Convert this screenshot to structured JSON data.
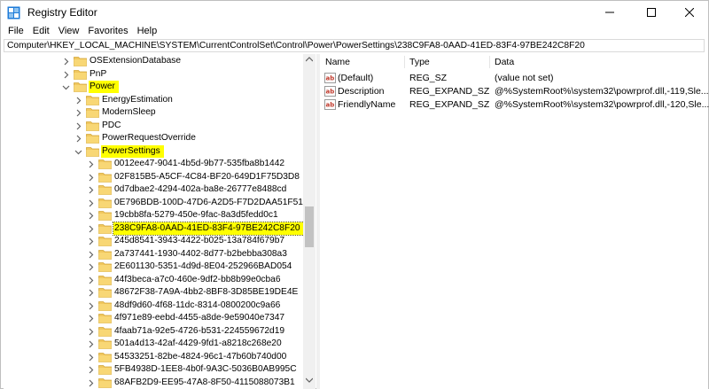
{
  "window": {
    "title": "Registry Editor"
  },
  "menu": [
    "File",
    "Edit",
    "View",
    "Favorites",
    "Help"
  ],
  "address": "Computer\\HKEY_LOCAL_MACHINE\\SYSTEM\\CurrentControlSet\\Control\\Power\\PowerSettings\\238C9FA8-0AAD-41ED-83F4-97BE242C8F20",
  "tree": [
    {
      "label": "OSExtensionDatabase",
      "expanded": false
    },
    {
      "label": "PnP",
      "expanded": false
    },
    {
      "label": "Power",
      "expanded": true,
      "highlight": true
    },
    {
      "label": "EnergyEstimation",
      "expanded": false
    },
    {
      "label": "ModernSleep",
      "expanded": false
    },
    {
      "label": "PDC",
      "expanded": false
    },
    {
      "label": "PowerRequestOverride",
      "expanded": false
    },
    {
      "label": "PowerSettings",
      "expanded": true,
      "highlight": true
    },
    {
      "label": "0012ee47-9041-4b5d-9b77-535fba8b1442",
      "expanded": false
    },
    {
      "label": "02F815B5-A5CF-4C84-BF20-649D1F75D3D8",
      "expanded": false
    },
    {
      "label": "0d7dbae2-4294-402a-ba8e-26777e8488cd",
      "expanded": false
    },
    {
      "label": "0E796BDB-100D-47D6-A2D5-F7D2DAA51F51",
      "expanded": false
    },
    {
      "label": "19cbb8fa-5279-450e-9fac-8a3d5fedd0c1",
      "expanded": false
    },
    {
      "label": "238C9FA8-0AAD-41ED-83F4-97BE242C8F20",
      "expanded": false,
      "selected": true,
      "highlight": true
    },
    {
      "label": "245d8541-3943-4422-b025-13a784f679b7",
      "expanded": false
    },
    {
      "label": "2a737441-1930-4402-8d77-b2bebba308a3",
      "expanded": false
    },
    {
      "label": "2E601130-5351-4d9d-8E04-252966BAD054",
      "expanded": false
    },
    {
      "label": "44f3beca-a7c0-460e-9df2-bb8b99e0cba6",
      "expanded": false
    },
    {
      "label": "48672F38-7A9A-4bb2-8BF8-3D85BE19DE4E",
      "expanded": false
    },
    {
      "label": "48df9d60-4f68-11dc-8314-0800200c9a66",
      "expanded": false
    },
    {
      "label": "4f971e89-eebd-4455-a8de-9e59040e7347",
      "expanded": false
    },
    {
      "label": "4faab71a-92e5-4726-b531-224559672d19",
      "expanded": false
    },
    {
      "label": "501a4d13-42af-4429-9fd1-a8218c268e20",
      "expanded": false
    },
    {
      "label": "54533251-82be-4824-96c1-47b60b740d00",
      "expanded": false
    },
    {
      "label": "5FB4938D-1EE8-4b0f-9A3C-5036B0AB995C",
      "expanded": false
    },
    {
      "label": "68AFB2D9-EE95-47A8-8F50-4115088073B1",
      "expanded": false
    }
  ],
  "values": {
    "columns": [
      "Name",
      "Type",
      "Data"
    ],
    "rows": [
      {
        "name": "(Default)",
        "type": "REG_SZ",
        "data": "(value not set)"
      },
      {
        "name": "Description",
        "type": "REG_EXPAND_SZ",
        "data": "@%SystemRoot%\\system32\\powrprof.dll,-119,Sle..."
      },
      {
        "name": "FriendlyName",
        "type": "REG_EXPAND_SZ",
        "data": "@%SystemRoot%\\system32\\powrprof.dll,-120,Sle..."
      }
    ]
  },
  "colors": {
    "highlight": "#ffff00",
    "folder": "#f0c75e",
    "chevron": "#606060",
    "ab_icon": "#c0392b"
  }
}
